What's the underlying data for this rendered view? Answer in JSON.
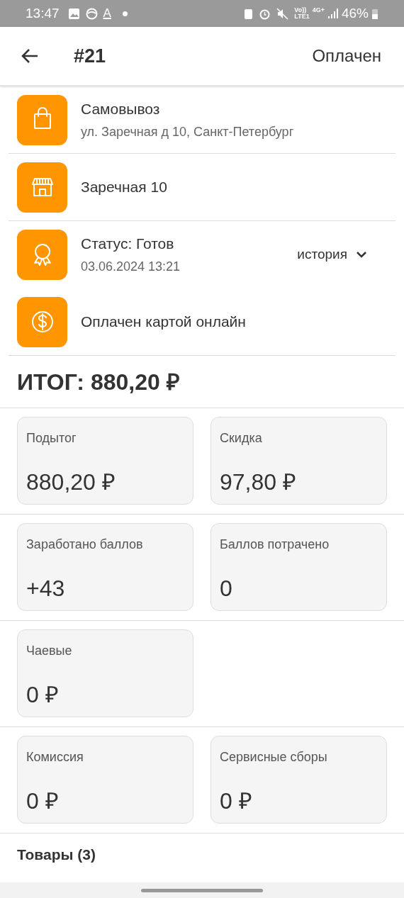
{
  "status_bar": {
    "time": "13:47",
    "letter": "A",
    "volte": "Vo))",
    "lte": "LTE1",
    "network": "4G+",
    "battery": "46%"
  },
  "header": {
    "title": "#21",
    "status": "Оплачен"
  },
  "info_rows": [
    {
      "kind": "pickup",
      "title": "Самовывоз",
      "subtitle": "ул. Заречная д 10, Санкт-Петербург",
      "divider_below": true
    },
    {
      "kind": "store",
      "title": "Заречная 10",
      "divider_below": true
    },
    {
      "kind": "status",
      "title": "Статус: Готов",
      "subtitle": "03.06.2024 13:21",
      "action": "история",
      "expanded": false,
      "divider_below": false
    },
    {
      "kind": "payment",
      "title": "Оплачен картой онлайн",
      "divider_below": true
    }
  ],
  "total": "ИТОГ: 880,20 ₽",
  "stat_groups": [
    [
      {
        "label": "Подытог",
        "value": "880,20 ₽"
      },
      {
        "label": "Скидка",
        "value": "97,80 ₽"
      }
    ],
    [
      {
        "label": "Заработано баллов",
        "value": "+43"
      },
      {
        "label": "Баллов потрачено",
        "value": "0"
      }
    ],
    [
      {
        "label": "Чаевые",
        "value": "0 ₽"
      }
    ],
    [
      {
        "label": "Комиссия",
        "value": "0 ₽"
      },
      {
        "label": "Сервисные сборы",
        "value": "0 ₽"
      }
    ]
  ],
  "products_heading": "Товары (3)"
}
